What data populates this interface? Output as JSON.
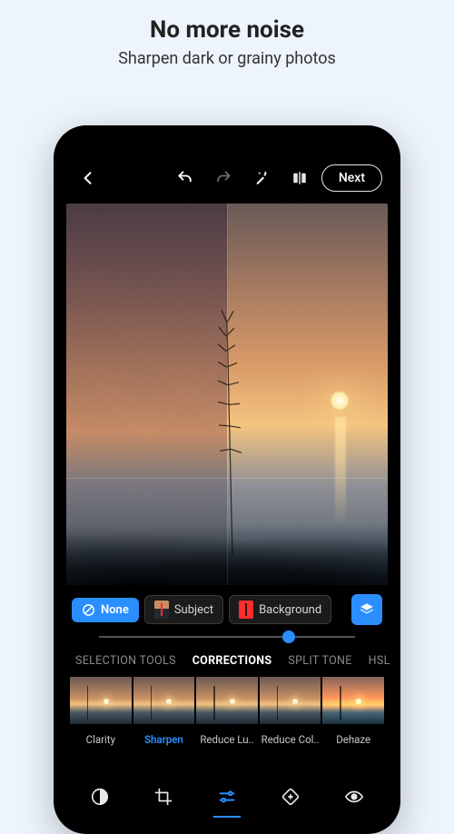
{
  "promo": {
    "title": "No more noise",
    "subtitle": "Sharpen dark or grainy photos"
  },
  "topbar": {
    "next_label": "Next"
  },
  "masks": {
    "none_label": "None",
    "subject_label": "Subject",
    "background_label": "Background"
  },
  "slider": {
    "value_pct": 74
  },
  "tabs": [
    {
      "label": "SELECTION TOOLS",
      "active": false
    },
    {
      "label": "CORRECTIONS",
      "active": true
    },
    {
      "label": "SPLIT TONE",
      "active": false
    },
    {
      "label": "HSL",
      "active": false
    }
  ],
  "corrections": [
    {
      "label": "Clarity",
      "active": false
    },
    {
      "label": "Sharpen",
      "active": true
    },
    {
      "label": "Reduce Lu..",
      "active": false
    },
    {
      "label": "Reduce Col..",
      "active": false
    },
    {
      "label": "Dehaze",
      "active": false,
      "warm": true
    }
  ],
  "colors": {
    "accent": "#2b8eff"
  }
}
